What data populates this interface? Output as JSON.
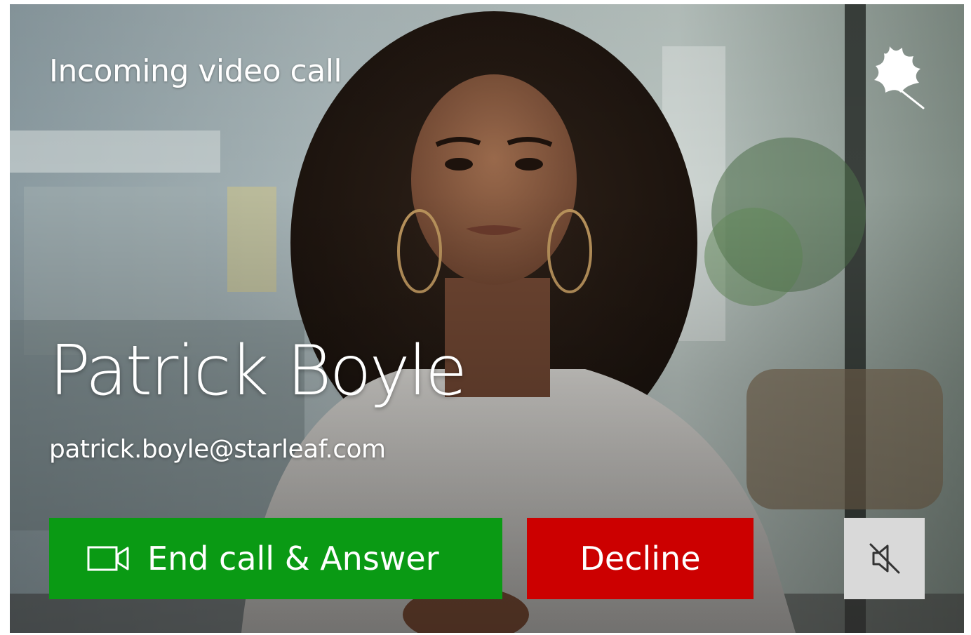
{
  "call": {
    "title": "Incoming video call",
    "caller_name": "Patrick Boyle",
    "caller_email": "patrick.boyle@starleaf.com"
  },
  "actions": {
    "answer_label": "End call & Answer",
    "answer_icon": "video-camera-icon",
    "decline_label": "Decline",
    "mute_icon": "speaker-muted-icon"
  },
  "brand": {
    "logo_icon": "starleaf-leaf-icon"
  },
  "colors": {
    "answer": "#0a9a14",
    "decline": "#cc0000",
    "mute": "#d9d9d9",
    "text": "#ffffff"
  }
}
